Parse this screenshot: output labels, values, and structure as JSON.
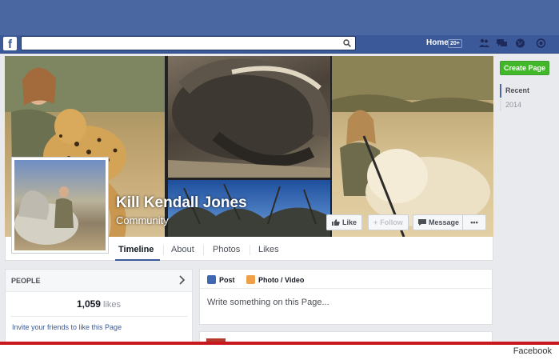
{
  "topbar": {
    "logo": "f",
    "home_label": "Home",
    "home_badge": "20+",
    "icons": [
      "friend-requests-icon",
      "messages-icon",
      "notifications-globe-icon",
      "account-icon"
    ]
  },
  "page": {
    "name": "Kill Kendall Jones",
    "category": "Community"
  },
  "cover_actions": {
    "like": "Like",
    "follow": "Follow",
    "message": "Message",
    "more": "•••"
  },
  "tabs": [
    "Timeline",
    "About",
    "Photos",
    "Likes"
  ],
  "right_column": {
    "create_page": "Create Page",
    "recent": "Recent",
    "year": "2014"
  },
  "people": {
    "title": "PEOPLE",
    "likes_count": "1,059",
    "likes_word": "likes",
    "invite": "Invite your friends to like this Page"
  },
  "composer": {
    "post_tab": "Post",
    "photo_tab": "Photo / Video",
    "placeholder": "Write something on this Page..."
  },
  "credit": "Facebook",
  "colors": {
    "brand": "#3b5998",
    "create_page": "#42b72a",
    "credit_line": "#c8171f"
  }
}
